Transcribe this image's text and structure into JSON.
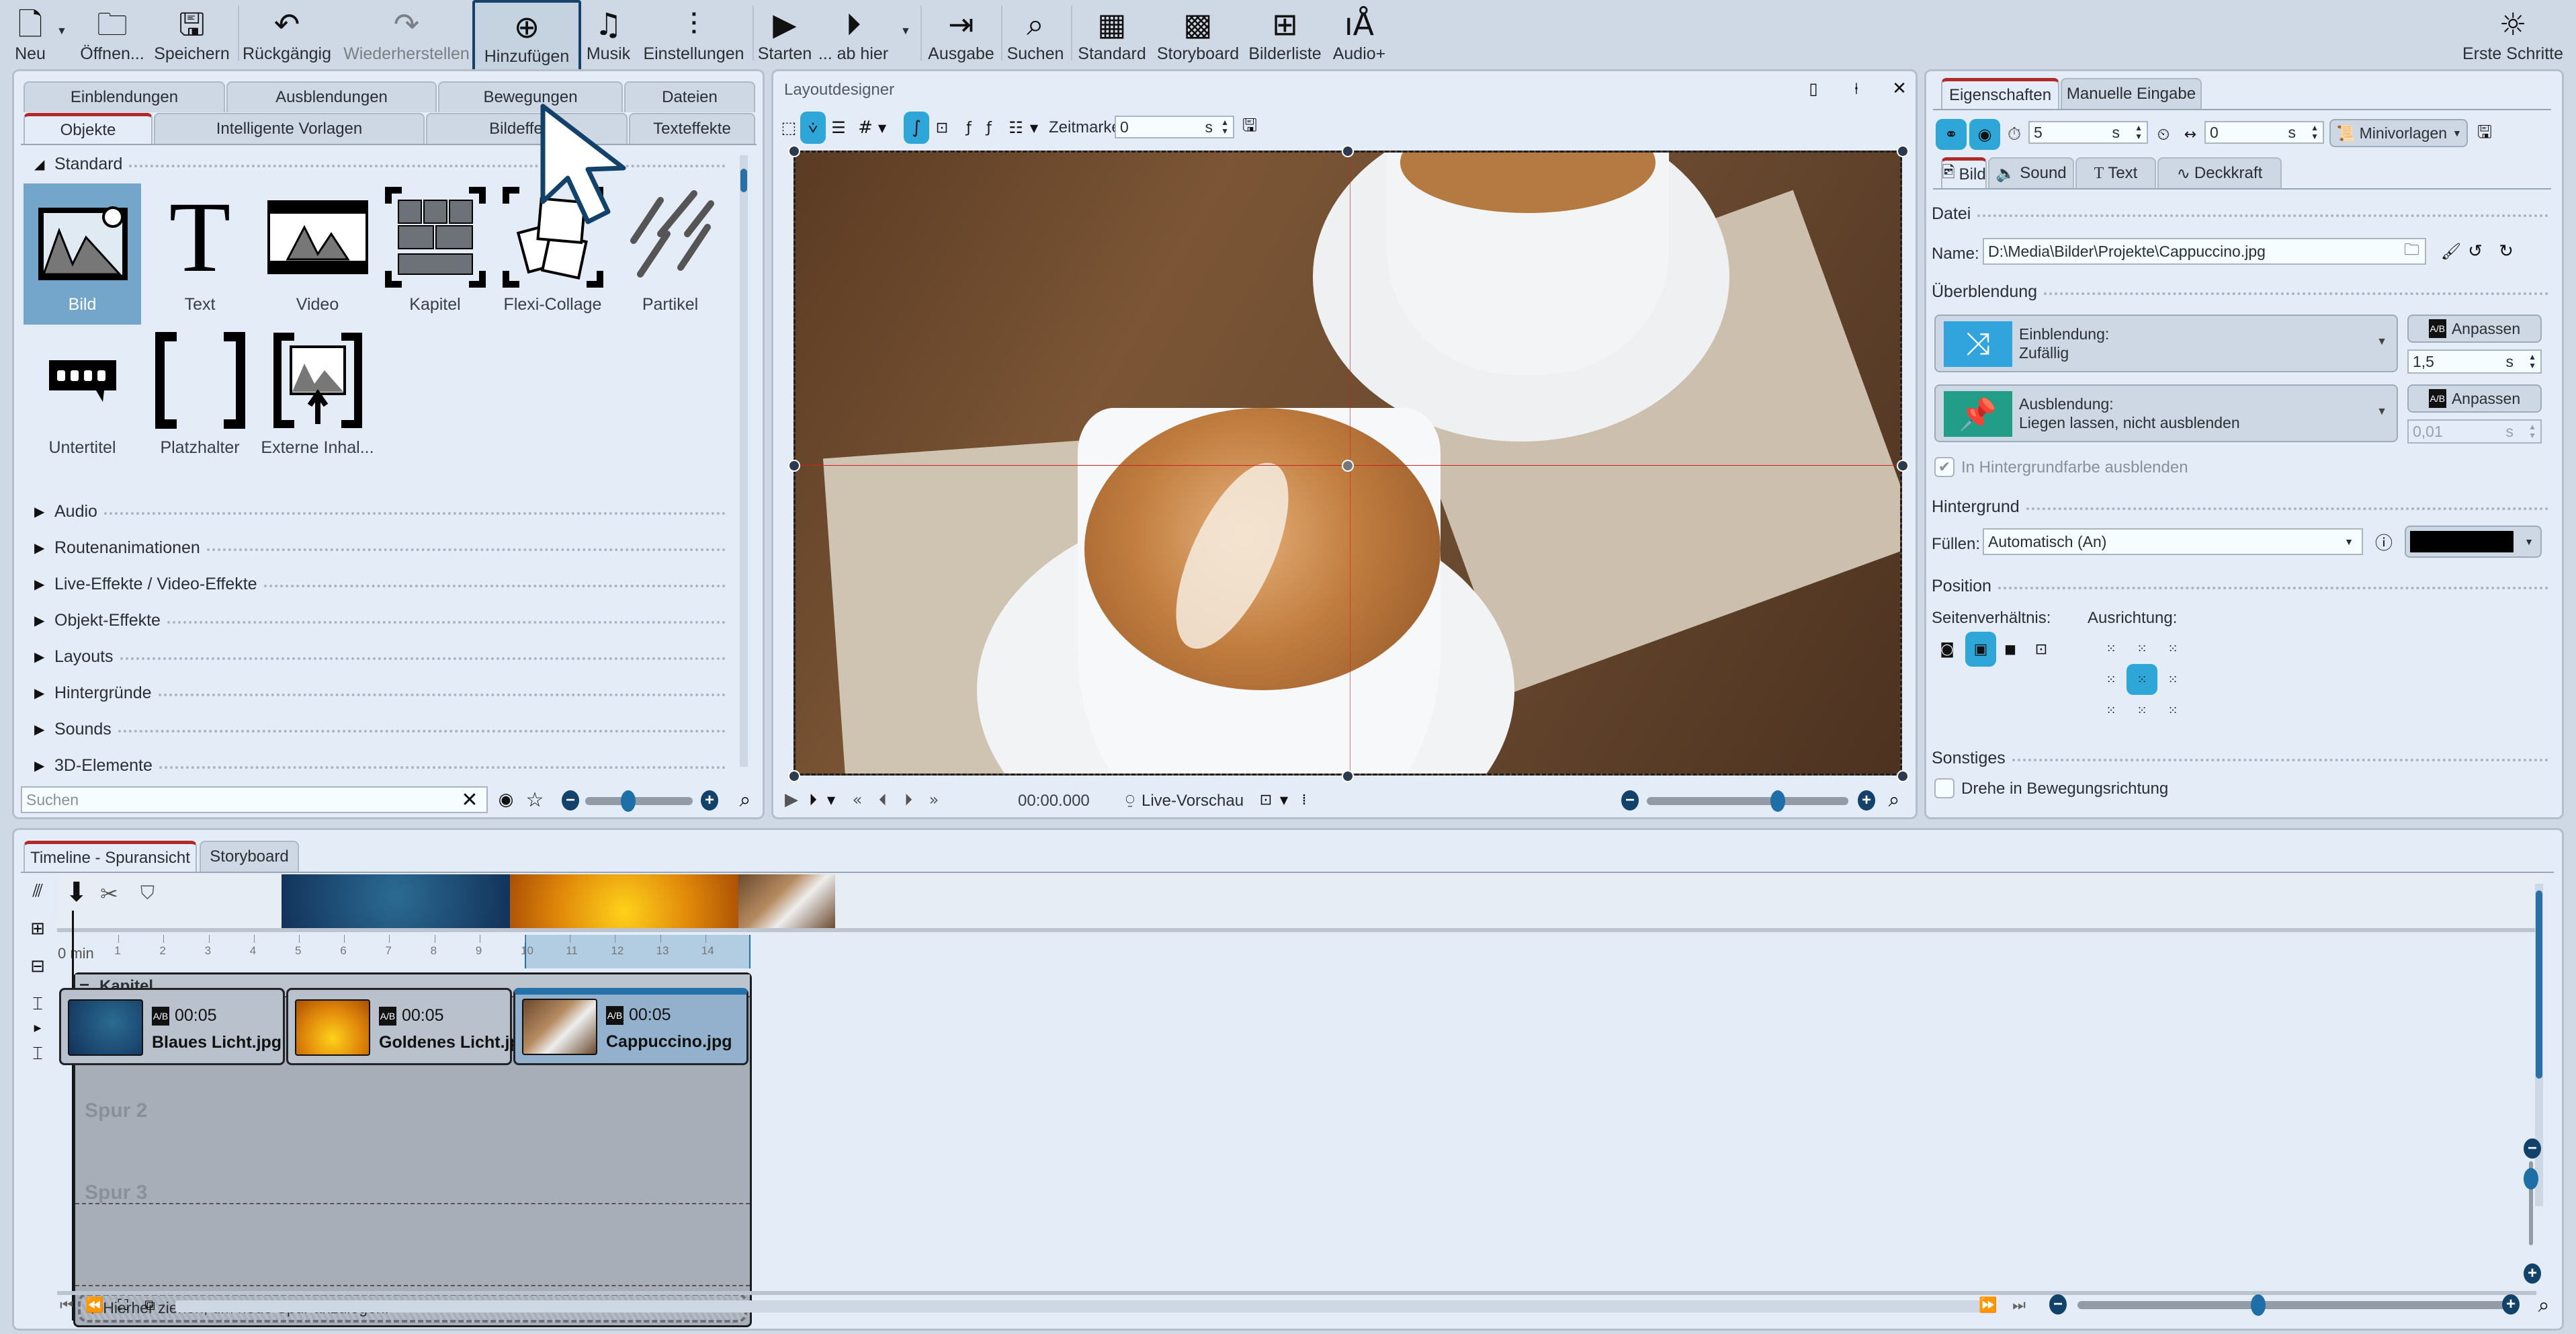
{
  "toolbar": {
    "items": [
      {
        "label": "Neu",
        "icon": "new-document-icon"
      },
      {
        "label": "Öffnen...",
        "icon": "open-folder-icon"
      },
      {
        "label": "Speichern",
        "icon": "save-icon"
      },
      {
        "label": "Rückgängig",
        "icon": "undo-icon"
      },
      {
        "label": "Wiederherstellen",
        "icon": "redo-icon",
        "disabled": true
      },
      {
        "label": "Hinzufügen",
        "icon": "add-circle-icon"
      },
      {
        "label": "Musik",
        "icon": "music-note-icon"
      },
      {
        "label": "Einstellungen",
        "icon": "sliders-icon"
      },
      {
        "label": "Starten",
        "icon": "play-icon"
      },
      {
        "label": "... ab hier",
        "icon": "play-from-here-icon"
      },
      {
        "label": "Ausgabe",
        "icon": "export-icon"
      },
      {
        "label": "Suchen",
        "icon": "search-icon"
      },
      {
        "label": "Standard",
        "icon": "layout-standard-icon"
      },
      {
        "label": "Storyboard",
        "icon": "layout-storyboard-icon"
      },
      {
        "label": "Bilderliste",
        "icon": "layout-imagelist-icon"
      },
      {
        "label": "Audio+",
        "icon": "layout-audio-icon"
      },
      {
        "label": "Erste Schritte",
        "icon": "lightbulb-icon"
      }
    ]
  },
  "toolbox": {
    "tabs_row1": [
      "Einblendungen",
      "Ausblendungen",
      "Bewegungen",
      "Dateien"
    ],
    "tabs_row2": [
      "Objekte",
      "Intelligente Vorlagen",
      "Bildeffekte",
      "Texteffekte"
    ],
    "active_tab": "Objekte",
    "expanded_section": "Standard",
    "objects": [
      "Bild",
      "Text",
      "Video",
      "Kapitel",
      "Flexi-Collage",
      "Partikel",
      "Untertitel",
      "Platzhalter",
      "Externe Inhal..."
    ],
    "selected_object": "Bild",
    "sections": [
      "Audio",
      "Routenanimationen",
      "Live-Effekte / Video-Effekte",
      "Objekt-Effekte",
      "Layouts",
      "Hintergründe",
      "Sounds",
      "3D-Elemente"
    ],
    "search_placeholder": "Suchen",
    "icon_size_slider": 0.4
  },
  "layoutdesigner": {
    "title": "Layoutdesigner",
    "zeitmarke_label": "Zeitmarke:",
    "zeitmarke_value": "0",
    "zeitmarke_unit": "s",
    "time": "00:00.000",
    "live_preview": "Live-Vorschau",
    "zoom_slider": 0.65
  },
  "properties": {
    "tabs": [
      "Eigenschaften",
      "Manuelle Eingabe"
    ],
    "active_tab": "Eigenschaften",
    "duration_value": "5",
    "duration_unit": "s",
    "offset_value": "0",
    "offset_unit": "s",
    "minivorlagen": "Minivorlagen",
    "subtabs": [
      "Bild",
      "Sound",
      "Text",
      "Deckkraft"
    ],
    "active_subtab": "Bild",
    "datei_heading": "Datei",
    "name_label": "Name:",
    "name_value": "D:\\Media\\Bilder\\Projekte\\Cappuccino.jpg",
    "ueberblendung_heading": "Überblendung",
    "einblendung_label": "Einblendung:",
    "einblendung_value": "Zufällig",
    "einblendung_duration": "1,5",
    "ausblendung_label": "Ausblendung:",
    "ausblendung_value": "Liegen lassen, nicht ausblenden",
    "ausblendung_duration": "0,01",
    "unit_s": "s",
    "anpassen": "Anpassen",
    "hintergrundfarbe_label": "In Hintergrundfarbe ausblenden",
    "hintergrundfarbe_checked": true,
    "hintergrund_heading": "Hintergrund",
    "fuellen_label": "Füllen:",
    "fuellen_value": "Automatisch (An)",
    "fill_color": "#000000",
    "position_heading": "Position",
    "seitenverhaeltnis_label": "Seitenverhältnis:",
    "ausrichtung_label": "Ausrichtung:",
    "sonstiges_heading": "Sonstiges",
    "drehe_label": "Drehe in Bewegungsrichtung",
    "drehe_checked": false
  },
  "timeline": {
    "tabs": [
      "Timeline - Spuransicht",
      "Storyboard"
    ],
    "active_tab": "Timeline - Spuransicht",
    "ruler_ticks": [
      "1",
      "2",
      "3",
      "4",
      "5",
      "6",
      "7",
      "8",
      "9",
      "10",
      "11",
      "12",
      "13",
      "14"
    ],
    "ruler_unit": "0 min",
    "chapter_label": "Kapitel",
    "clips": [
      {
        "duration": "00:05",
        "name": "Blaues Licht.jpg",
        "color": "#1b3a63"
      },
      {
        "duration": "00:05",
        "name": "Goldenes Licht.jpg",
        "color": "#e69a0c"
      },
      {
        "duration": "00:05",
        "name": "Cappuccino.jpg",
        "color": "#8a6a4c",
        "selected": true
      }
    ],
    "tracks": [
      "Spur 2",
      "Spur 3"
    ],
    "drop_hint": "Hierher ziehen, um neue Spur anzulegen.",
    "zoom_slider": 0.42
  },
  "colors": {
    "accent": "#2fa6d8",
    "active_tab": "#b02a2a",
    "selection": "#74a6cc",
    "slider": "#1e6fa8",
    "dark_button": "#12426a"
  }
}
